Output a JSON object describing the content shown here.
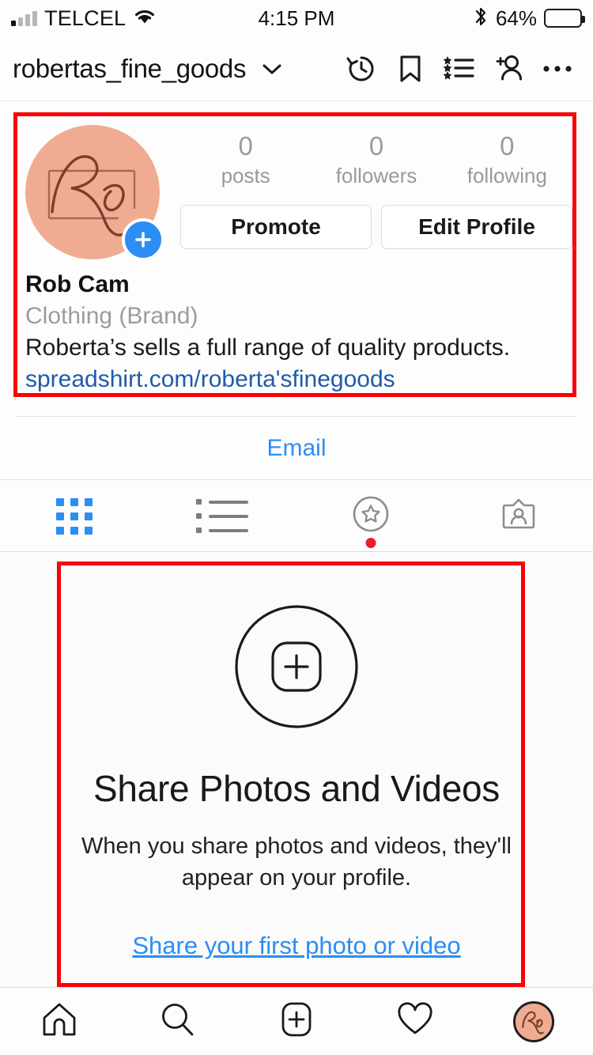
{
  "status_bar": {
    "carrier": "TELCEL",
    "time": "4:15 PM",
    "battery_percent": "64%",
    "battery_level": 64,
    "wifi_icon": "wifi-icon",
    "bluetooth_icon": "bluetooth-icon",
    "signal_icon": "cellular-signal-icon"
  },
  "nav": {
    "username": "robertas_fine_goods",
    "chevron_icon": "chevron-down-icon",
    "icons": [
      {
        "name": "archive-history-icon",
        "label": "Archive"
      },
      {
        "name": "bookmark-saved-icon",
        "label": "Saved"
      },
      {
        "name": "close-friends-list-icon",
        "label": "Close Friends"
      },
      {
        "name": "add-person-icon",
        "label": "Discover People"
      },
      {
        "name": "more-options-icon",
        "label": "Options"
      }
    ]
  },
  "profile": {
    "avatar_bg": "#efac92",
    "avatar_monogram": "Ro",
    "add_story_badge": "+",
    "stats": [
      {
        "value": "0",
        "label": "posts"
      },
      {
        "value": "0",
        "label": "followers"
      },
      {
        "value": "0",
        "label": "following"
      }
    ],
    "buttons": [
      {
        "name": "promote-button",
        "label": "Promote"
      },
      {
        "name": "edit-profile-button",
        "label": "Edit Profile"
      }
    ],
    "display_name": "Rob Cam",
    "category": "Clothing (Brand)",
    "bio": "Roberta’s sells a full range of quality products.",
    "website": "spreadshirt.com/roberta'sfinegoods",
    "link_color": "#1f5ba8"
  },
  "contact": {
    "email_label": "Email",
    "accent": "#2b8ef3"
  },
  "content_tabs": [
    {
      "name": "tab-grid",
      "icon": "grid-icon",
      "active": true,
      "badge": false
    },
    {
      "name": "tab-list",
      "icon": "list-icon",
      "active": false,
      "badge": false
    },
    {
      "name": "tab-saved-collections",
      "icon": "star-circle-icon",
      "active": false,
      "badge": true
    },
    {
      "name": "tab-tagged",
      "icon": "tagged-person-icon",
      "active": false,
      "badge": false
    }
  ],
  "empty_state": {
    "icon": "camera-plus-icon",
    "title": "Share Photos and Videos",
    "subtitle": "When you share photos and videos, they'll appear on your profile.",
    "cta": "Share your first photo or video"
  },
  "bottom_nav": [
    {
      "name": "nav-home",
      "icon": "home-icon",
      "active": false
    },
    {
      "name": "nav-search",
      "icon": "search-icon",
      "active": false
    },
    {
      "name": "nav-add-post",
      "icon": "plus-square-icon",
      "active": false
    },
    {
      "name": "nav-activity",
      "icon": "heart-icon",
      "active": false
    },
    {
      "name": "nav-profile",
      "icon": "profile-avatar-icon",
      "active": true
    }
  ],
  "annotations": {
    "highlight_color": "#fb0007",
    "boxes": [
      {
        "name": "profile-header-highlight"
      },
      {
        "name": "empty-state-highlight"
      }
    ]
  }
}
